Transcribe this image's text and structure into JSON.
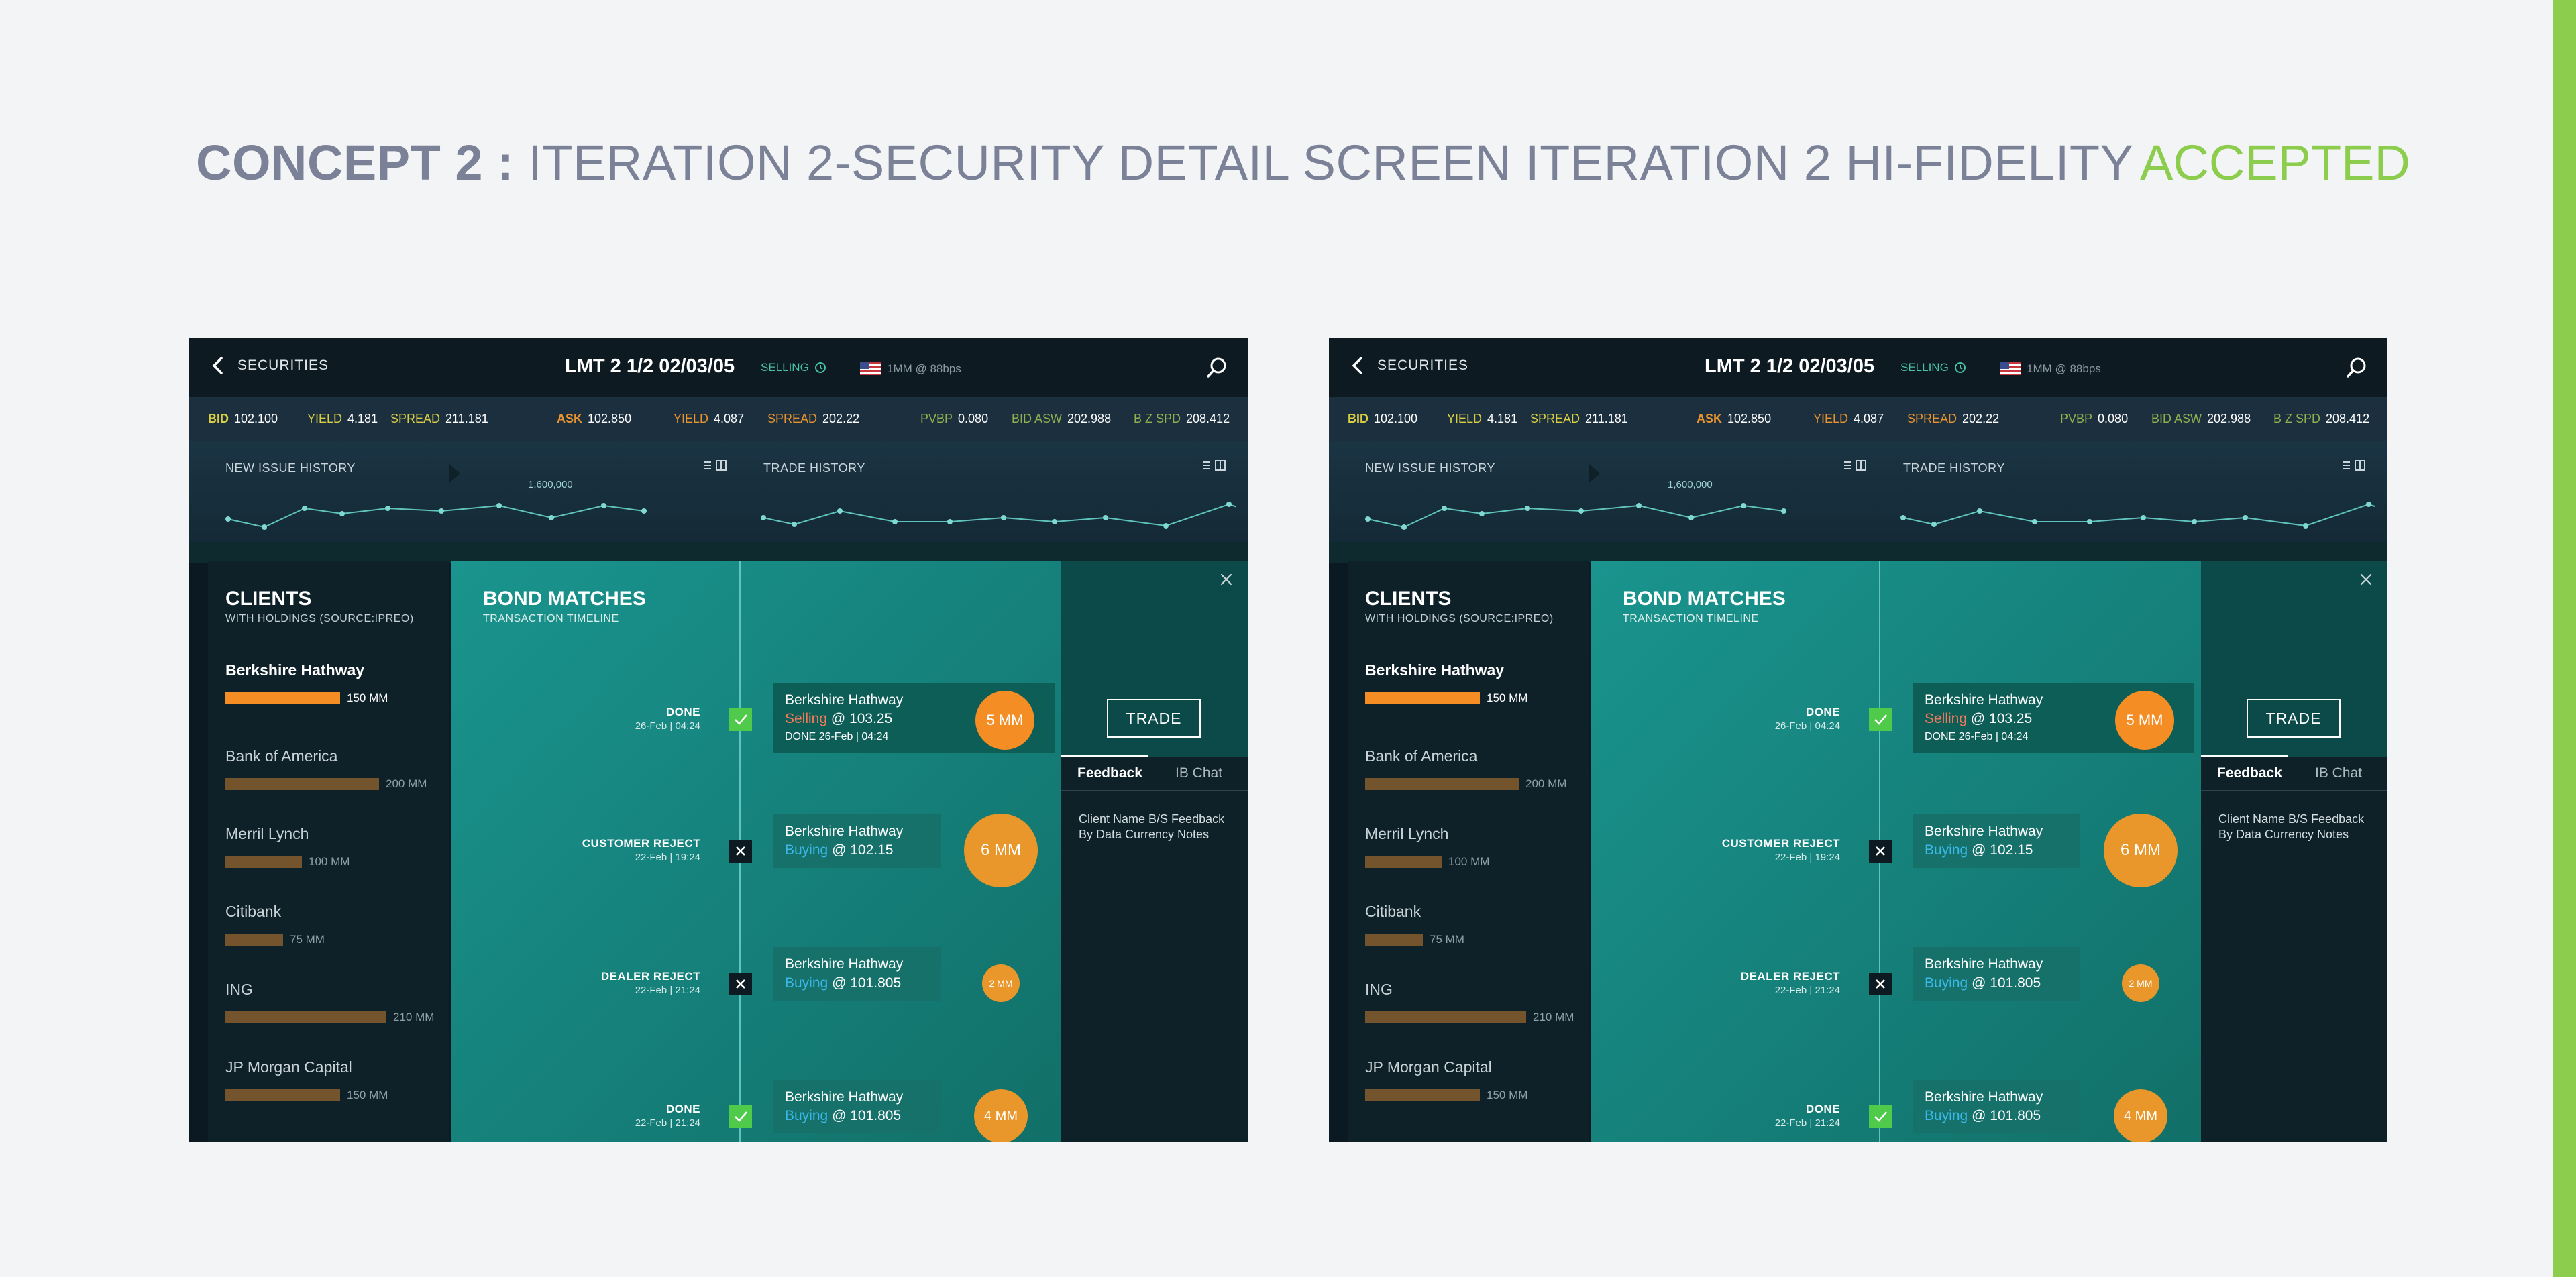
{
  "page": {
    "title_bold": "CONCEPT 2 :",
    "title_rest": " ITERATION 2-SECURITY DETAIL SCREEN ITERATION 2 HI-FIDELITY",
    "status": "ACCEPTED"
  },
  "colors": {
    "accent_green": "#8ccd4e",
    "buy_blue": "#3bb8e6",
    "sell_red": "#f47a5a",
    "highlight_orange": "#f58d25",
    "teal_panel": "#1a948e"
  },
  "screen": {
    "back_label": "SECURITIES",
    "security_title": "LMT 2 1/2 02/03/05",
    "selling_status": "SELLING",
    "size_info": "1MM @ 88bps",
    "prices": {
      "bid_label": "BID",
      "bid_value": "102.100",
      "yield1_label": "YIELD",
      "yield1_value": "4.181",
      "spread1_label": "SPREAD",
      "spread1_value": "211.181",
      "ask_label": "ASK",
      "ask_value": "102.850",
      "yield2_label": "YIELD",
      "yield2_value": "4.087",
      "spread2_label": "SPREAD",
      "spread2_value": "202.22",
      "pvbp_label": "PVBP",
      "pvbp_value": "0.080",
      "bidasw_label": "BID ASW",
      "bidasw_value": "202.988",
      "bzspd_label": "B Z SPD",
      "bzspd_value": "208.412"
    },
    "charts": {
      "new_issue_title": "NEW ISSUE HISTORY",
      "trade_title": "TRADE HISTORY",
      "peak_label": "1,600,000"
    },
    "clients": {
      "heading": "CLIENTS",
      "sub": "WITH HOLDINGS (SOURCE:IPREO)",
      "items": [
        {
          "name": "Berkshire Hathway",
          "amount": "150 MM",
          "holding_mm": 150,
          "active": true
        },
        {
          "name": "Bank of America",
          "amount": "200 MM",
          "holding_mm": 200,
          "active": false
        },
        {
          "name": "Merril Lynch",
          "amount": "100 MM",
          "holding_mm": 100,
          "active": false
        },
        {
          "name": "Citibank",
          "amount": "75 MM",
          "holding_mm": 75,
          "active": false
        },
        {
          "name": "ING",
          "amount": "210 MM",
          "holding_mm": 210,
          "active": false
        },
        {
          "name": "JP Morgan Capital",
          "amount": "150 MM",
          "holding_mm": 150,
          "active": false
        }
      ]
    },
    "bond": {
      "heading": "BOND MATCHES",
      "sub": "TRANSACTION TIMELINE",
      "events": [
        {
          "status": "DONE",
          "date": "26-Feb | 04:24",
          "mark": "done",
          "name": "Berkshire Hathway",
          "action": "Selling",
          "price": "@ 103.25",
          "done_line": "DONE 26-Feb | 04:24",
          "size": "5 MM"
        },
        {
          "status": "CUSTOMER REJECT",
          "date": "22-Feb | 19:24",
          "mark": "reject",
          "name": "Berkshire Hathway",
          "action": "Buying",
          "price": "@ 102.15",
          "done_line": "",
          "size": "6 MM"
        },
        {
          "status": "DEALER REJECT",
          "date": "22-Feb | 21:24",
          "mark": "reject",
          "name": "Berkshire Hathway",
          "action": "Buying",
          "price": "@ 101.805",
          "done_line": "",
          "size": "2 MM"
        },
        {
          "status": "DONE",
          "date": "22-Feb | 21:24",
          "mark": "done",
          "name": "Berkshire Hathway",
          "action": "Buying",
          "price": "@ 101.805",
          "done_line": "",
          "size": "4 MM"
        }
      ]
    },
    "side": {
      "trade_label": "TRADE",
      "tab_feedback": "Feedback",
      "tab_ibchat": "IB Chat",
      "feedback_text": "Client Name B/S Feedback By Data Currency Notes"
    }
  }
}
